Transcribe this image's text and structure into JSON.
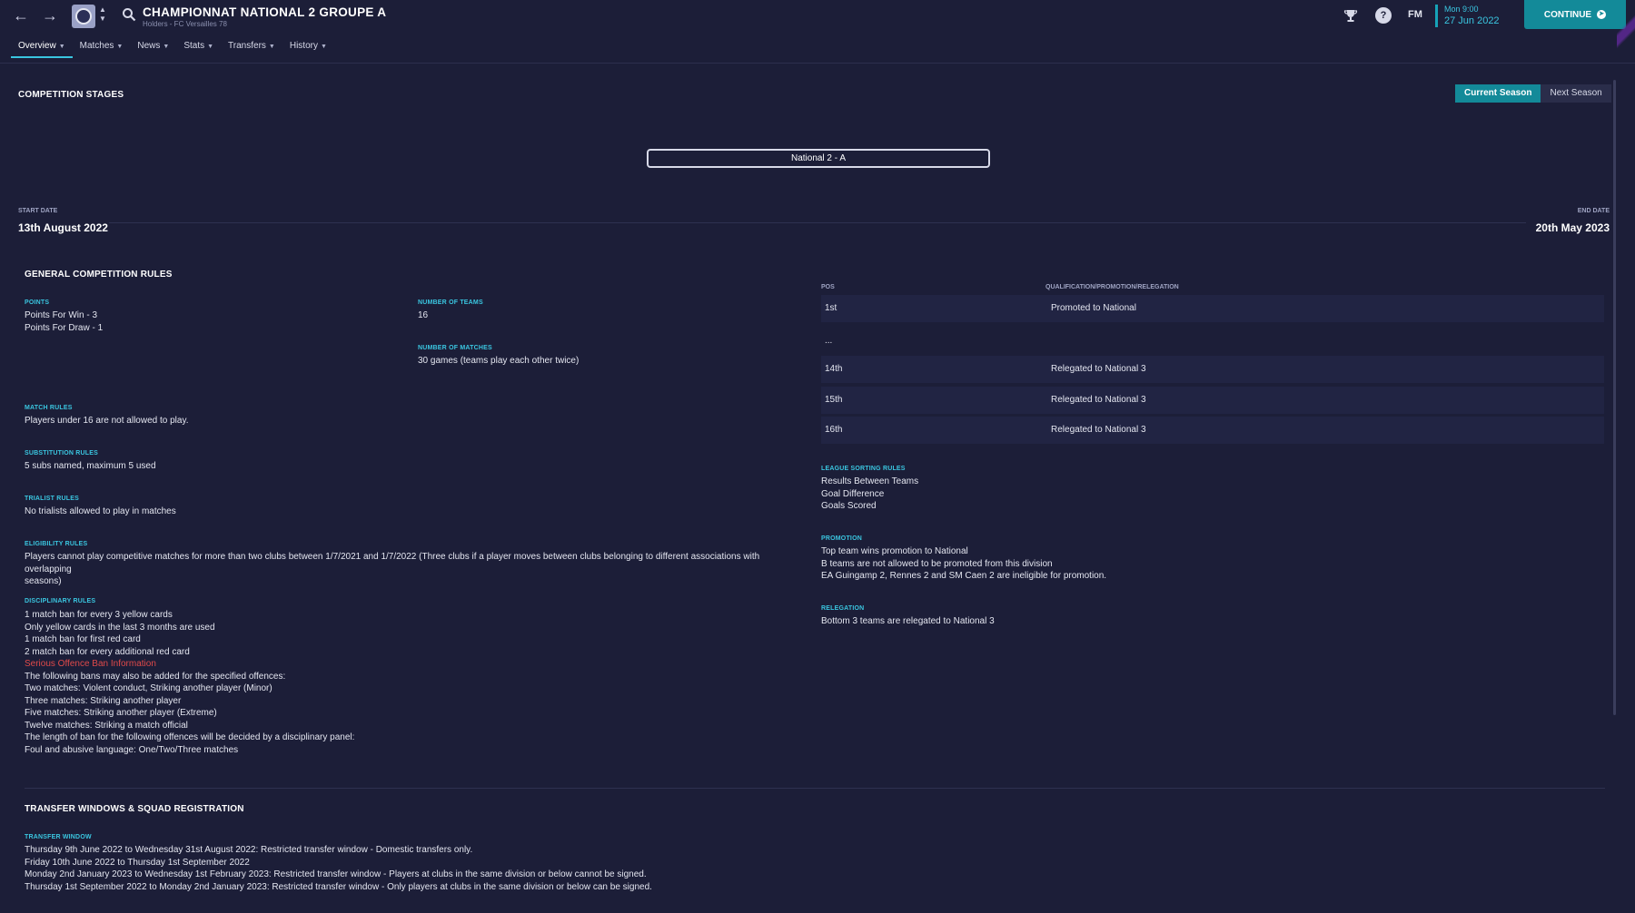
{
  "header": {
    "title": "CHAMPIONNAT NATIONAL 2 GROUPE A",
    "subtitle": "Holders - FC Versailles 78",
    "tabs": [
      {
        "label": "Overview"
      },
      {
        "label": "Matches"
      },
      {
        "label": "News"
      },
      {
        "label": "Stats"
      },
      {
        "label": "Transfers"
      },
      {
        "label": "History"
      }
    ],
    "fm_logo": "FM",
    "time": "Mon 9:00",
    "date": "27 Jun 2022",
    "continue_label": "CONTINUE"
  },
  "stages": {
    "title": "COMPETITION STAGES",
    "current_season": "Current Season",
    "next_season": "Next Season",
    "stage_name": "National 2 - A",
    "start_label": "START DATE",
    "start_date": "13th August 2022",
    "end_label": "END DATE",
    "end_date": "20th May 2023"
  },
  "rules": {
    "title": "GENERAL COMPETITION RULES",
    "points_label": "POINTS",
    "points_lines": [
      "Points For Win - 3",
      "Points For Draw - 1"
    ],
    "teams_label": "NUMBER OF TEAMS",
    "teams_value": "16",
    "matches_label": "NUMBER OF MATCHES",
    "matches_value": "30 games (teams play each other twice)",
    "match_rules_label": "MATCH RULES",
    "match_rules_value": "Players under 16 are not allowed to play.",
    "sub_rules_label": "SUBSTITUTION RULES",
    "sub_rules_value": "5 subs named, maximum 5 used",
    "trialist_label": "TRIALIST RULES",
    "trialist_value": "No trialists allowed to play in matches",
    "eligibility_label": "ELIGIBILITY RULES",
    "eligibility_lines": [
      "Players cannot play competitive matches for more than two clubs between 1/7/2021 and 1/7/2022 (Three clubs if a player moves between clubs belonging to different associations with overlapping",
      "seasons)"
    ],
    "disciplinary_label": "DISCIPLINARY RULES",
    "disciplinary_lines_a": [
      "1 match ban for every 3 yellow cards",
      "Only yellow cards in the last 3 months are used",
      "1 match ban for first red card",
      "2 match ban for every additional red card"
    ],
    "serious_offence_link": "Serious Offence Ban Information",
    "disciplinary_lines_b": [
      "The following bans may also be added for the specified offences:",
      "Two matches: Violent conduct, Striking another player (Minor)",
      "Three matches: Striking another player",
      "Five matches: Striking another player (Extreme)",
      "Twelve matches: Striking a match official",
      "The length of ban for the following offences will be decided by a disciplinary panel:",
      "Foul and abusive language: One/Two/Three matches"
    ]
  },
  "standings": {
    "pos_header": "POS",
    "qual_header": "QUALIFICATION/PROMOTION/RELEGATION",
    "rows": [
      {
        "pos": "1st",
        "qual": "Promoted to National"
      },
      {
        "pos": "...",
        "qual": ""
      },
      {
        "pos": "14th",
        "qual": "Relegated to National 3"
      },
      {
        "pos": "15th",
        "qual": "Relegated to National 3"
      },
      {
        "pos": "16th",
        "qual": "Relegated to National 3"
      }
    ],
    "sorting_label": "LEAGUE SORTING RULES",
    "sorting_lines": [
      "Results Between Teams",
      "Goal Difference",
      "Goals Scored"
    ],
    "promotion_label": "PROMOTION",
    "promotion_lines": [
      "Top team wins promotion to National",
      "B teams are not allowed to be promoted from this division",
      "EA Guingamp 2, Rennes 2 and SM Caen 2 are ineligible for promotion."
    ],
    "relegation_label": "RELEGATION",
    "relegation_value": "Bottom 3 teams are relegated to National 3"
  },
  "transfer": {
    "title": "TRANSFER WINDOWS & SQUAD REGISTRATION",
    "window_label": "TRANSFER WINDOW",
    "window_lines": [
      "Thursday 9th June 2022 to Wednesday 31st August 2022: Restricted transfer window - Domestic transfers only.",
      "Friday 10th June 2022 to Thursday 1st September 2022",
      "Monday 2nd January 2023 to Wednesday 1st February 2023: Restricted transfer window - Players at clubs in the same division or below cannot be signed.",
      "Thursday 1st September 2022 to Monday 2nd January 2023: Restricted transfer window - Only players at clubs in the same division or below can be signed."
    ]
  },
  "icons": {
    "back": "arrow-left-icon",
    "forward": "arrow-right-icon",
    "search": "search-icon",
    "trophy": "trophy-icon",
    "help": "help-icon",
    "continue": "continue-arrow-icon"
  },
  "colors": {
    "background": "#1c1e38",
    "accent": "#3ac6e0",
    "button": "#138a99",
    "danger": "#e04a4a"
  }
}
